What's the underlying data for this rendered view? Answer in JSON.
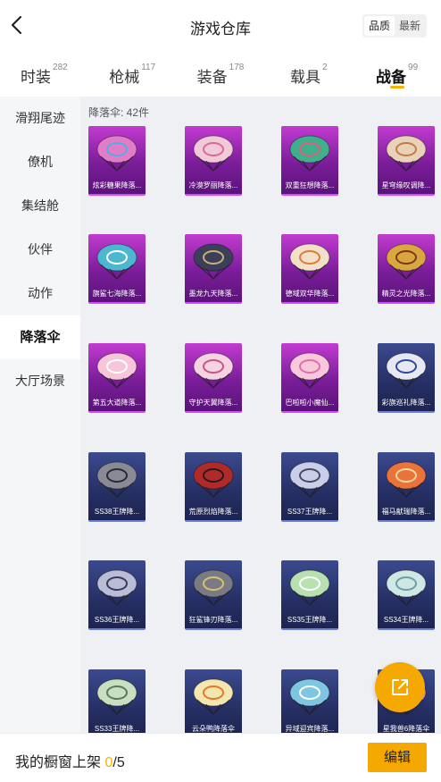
{
  "header": {
    "title": "游戏仓库",
    "sort_options": [
      "品质",
      "最新"
    ],
    "sort_active": "品质"
  },
  "tabs": [
    {
      "label": "时装",
      "count": "282"
    },
    {
      "label": "枪械",
      "count": "117"
    },
    {
      "label": "装备",
      "count": "178"
    },
    {
      "label": "载具",
      "count": "2"
    },
    {
      "label": "战备",
      "count": "99"
    }
  ],
  "sidebar": {
    "items": [
      {
        "label": "滑翔尾迹"
      },
      {
        "label": "僚机"
      },
      {
        "label": "集结舱"
      },
      {
        "label": "伙伴"
      },
      {
        "label": "动作"
      },
      {
        "label": "降落伞"
      },
      {
        "label": "大厅场景"
      }
    ]
  },
  "content": {
    "count_label": "降落伞: 42件",
    "items": [
      {
        "name": "炫彩糖果降落...",
        "tier": "purple",
        "color": "#e27cc7",
        "accent": "#4fb0e0"
      },
      {
        "name": "冷漠罗丽降落...",
        "tier": "purple",
        "color": "#f2c9d9",
        "accent": "#d76a9a"
      },
      {
        "name": "双重狂想降落...",
        "tier": "purple",
        "color": "#3fb08a",
        "accent": "#e25a8a"
      },
      {
        "name": "星穹缘叹调降...",
        "tier": "purple",
        "color": "#e9d2b8",
        "accent": "#c07d4a"
      },
      {
        "name": "旗鲨七海降落...",
        "tier": "purple",
        "color": "#4bb7d0",
        "accent": "#ffffff"
      },
      {
        "name": "墨龙九天降落...",
        "tier": "purple",
        "color": "#3b3f5a",
        "accent": "#c9b07a"
      },
      {
        "name": "德域双华降落...",
        "tier": "purple",
        "color": "#f2e0c8",
        "accent": "#e07a3a"
      },
      {
        "name": "精灵之光降落...",
        "tier": "purple",
        "color": "#d9a640",
        "accent": "#7a3a1a"
      },
      {
        "name": "第五大道降落...",
        "tier": "purple",
        "color": "#f7c6d9",
        "accent": "#ffffff"
      },
      {
        "name": "守护天翼降落...",
        "tier": "purple",
        "color": "#f5d3e0",
        "accent": "#c9548a"
      },
      {
        "name": "巴啦啦小魔仙...",
        "tier": "purple",
        "color": "#f9c8dc",
        "accent": "#e36ea7"
      },
      {
        "name": "彩旗巡礼降落...",
        "tier": "blue",
        "color": "#e8e8f2",
        "accent": "#2f4aa0"
      },
      {
        "name": "SS38王牌降...",
        "tier": "blue",
        "color": "#8a8a96",
        "accent": "#2a2a36"
      },
      {
        "name": "荒原烈焰降落...",
        "tier": "blue",
        "color": "#b02a2a",
        "accent": "#2a1a1a"
      },
      {
        "name": "SS37王牌降...",
        "tier": "blue",
        "color": "#c9cfe8",
        "accent": "#4a4a66"
      },
      {
        "name": "福马献瑞降落...",
        "tier": "blue",
        "color": "#e8743a",
        "accent": "#f2d4a0"
      },
      {
        "name": "SS36王牌降...",
        "tier": "blue",
        "color": "#b9bdd6",
        "accent": "#3a3a5a"
      },
      {
        "name": "狂鲨锋刃降落...",
        "tier": "blue",
        "color": "#7a7a82",
        "accent": "#d9c070"
      },
      {
        "name": "SS35王牌降...",
        "tier": "blue",
        "color": "#b9e0b0",
        "accent": "#ffffff"
      },
      {
        "name": "SS34王牌降...",
        "tier": "blue",
        "color": "#cfe8e6",
        "accent": "#6aa0a0"
      },
      {
        "name": "SS33王牌降...",
        "tier": "blue",
        "color": "#c9e0c0",
        "accent": "#5a7a5a"
      },
      {
        "name": "云朵鸭降落伞",
        "tier": "blue",
        "color": "#f5e6b0",
        "accent": "#e07a2a"
      },
      {
        "name": "异域迎宾降落...",
        "tier": "blue",
        "color": "#7fc7e0",
        "accent": "#ffffff"
      },
      {
        "name": "星我兽6降落伞",
        "tier": "blue",
        "color": "#f29a9a",
        "accent": "#5a6ab0"
      }
    ]
  },
  "footer": {
    "label": "我的橱窗上架",
    "current": "0",
    "total": "/5",
    "edit_label": "编辑"
  },
  "icons": {
    "back": "chevron-left-icon",
    "share": "share-external-icon",
    "parachute": "parachute-icon"
  }
}
